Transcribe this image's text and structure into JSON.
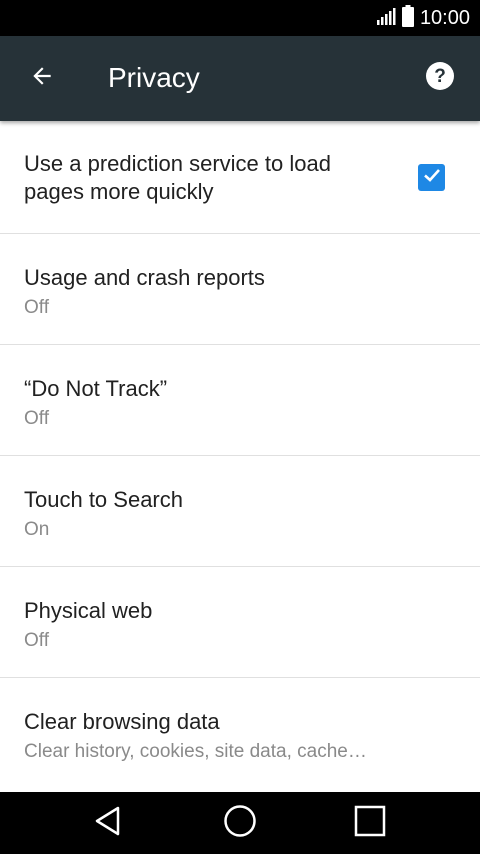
{
  "status_bar": {
    "time": "10:00",
    "signal_icon": "signal-icon",
    "battery_icon": "battery-icon"
  },
  "toolbar": {
    "title": "Privacy",
    "back_icon": "arrow-back-icon",
    "help_icon": "help-icon"
  },
  "settings": [
    {
      "title": "Use a prediction service to load pages more quickly",
      "checked": true
    },
    {
      "title": "Usage and crash reports",
      "subtitle": "Off"
    },
    {
      "title": "“Do Not Track”",
      "subtitle": "Off"
    },
    {
      "title": "Touch to Search",
      "subtitle": "On"
    },
    {
      "title": "Physical web",
      "subtitle": "Off"
    },
    {
      "title": "Clear browsing data",
      "subtitle": "Clear history, cookies, site data, cache…"
    }
  ],
  "nav_bar": {
    "back_icon": "nav-back-icon",
    "home_icon": "nav-home-icon",
    "recents_icon": "nav-recents-icon"
  },
  "colors": {
    "toolbar": "#263238",
    "accent": "#1e88e5",
    "status_bar": "#000000"
  }
}
